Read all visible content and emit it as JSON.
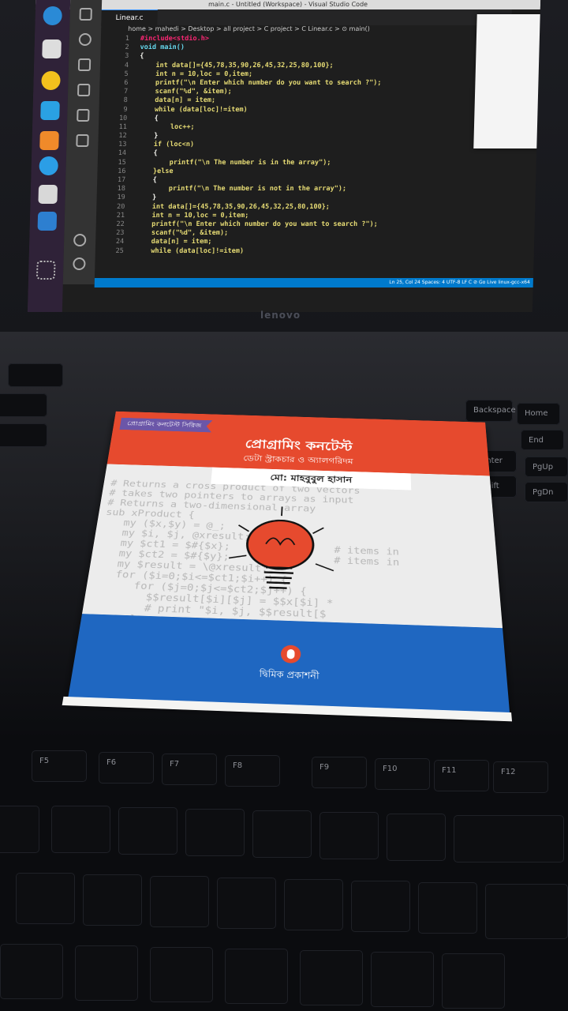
{
  "window_title": "main.c - Untitled (Workspace) - Visual Studio Code",
  "tab": {
    "label": "Linear.c"
  },
  "breadcrumb": "home > mahedi > Desktop > all project > C project > C Linear.c > ⊙ main()",
  "code_lines": [
    {
      "n": "1",
      "t": "#include<stdio.h>",
      "c": "pp"
    },
    {
      "n": "2",
      "t": "void main()",
      "c": "kw"
    },
    {
      "n": "3",
      "t": "{",
      "c": "plain"
    },
    {
      "n": "4",
      "t": "    int data[]={45,78,35,90,26,45,32,25,80,100};",
      "c": "code"
    },
    {
      "n": "5",
      "t": "    int n = 10,loc = 0,item;",
      "c": "code"
    },
    {
      "n": "6",
      "t": "    printf(\"\\n Enter which number do you want to search ?\");",
      "c": "code"
    },
    {
      "n": "7",
      "t": "    scanf(\"%d\", &item);",
      "c": "code"
    },
    {
      "n": "8",
      "t": "    data[n] = item;",
      "c": "code"
    },
    {
      "n": "9",
      "t": "    while (data[loc]!=item)",
      "c": "code"
    },
    {
      "n": "10",
      "t": "    {",
      "c": "plain"
    },
    {
      "n": "11",
      "t": "        loc++;",
      "c": "code"
    },
    {
      "n": "12",
      "t": "    }",
      "c": "plain"
    },
    {
      "n": "13",
      "t": "    if (loc<n)",
      "c": "code"
    },
    {
      "n": "14",
      "t": "    {",
      "c": "plain"
    },
    {
      "n": "15",
      "t": "        printf(\"\\n The number is in the array\");",
      "c": "code"
    },
    {
      "n": "16",
      "t": "    }else",
      "c": "code"
    },
    {
      "n": "17",
      "t": "    {",
      "c": "plain"
    },
    {
      "n": "18",
      "t": "        printf(\"\\n The number is not in the array\");",
      "c": "code"
    },
    {
      "n": "19",
      "t": "    }",
      "c": "plain"
    },
    {
      "n": "20",
      "t": "    int data[]={45,78,35,90,26,45,32,25,80,100};",
      "c": "code"
    },
    {
      "n": "21",
      "t": "    int n = 10,loc = 0,item;",
      "c": "code"
    },
    {
      "n": "22",
      "t": "    printf(\"\\n Enter which number do you want to search ?\");",
      "c": "code"
    },
    {
      "n": "23",
      "t": "    scanf(\"%d\", &item);",
      "c": "code"
    },
    {
      "n": "24",
      "t": "    data[n] = item;",
      "c": "code"
    },
    {
      "n": "25",
      "t": "    while (data[loc]!=item)",
      "c": "code"
    }
  ],
  "status_right": "Ln 25, Col 24   Spaces: 4   UTF-8   LF   C   ⊘ Go Live   linux-gcc-x64",
  "laptop_brand": "lenovo",
  "keys": [
    "F5",
    "F6",
    "F7",
    "F8",
    "F9",
    "F10",
    "F11",
    "F12",
    "Enter",
    "Shift",
    "Backspace",
    "Home",
    "End",
    "PgUp",
    "PgDn"
  ],
  "book": {
    "series": "প্রোগ্রামিং কনটেস্ট সিরিজ",
    "title": "প্রোগ্রামিং কনটেস্ট",
    "subtitle": "ডেটা স্ট্রাকচার ও অ্যালগরিদম",
    "author": "মো: মাহবুবুল হাসান",
    "publisher": "দ্বিমিক প্রকাশনী",
    "background_code": "# Returns a cross product of two vectors\n# takes two pointers to arrays as input\n# Returns a two-dimensional array\nsub xProduct {\n   my ($x,$y) = @_;\n   my $i, $j, @xresult;\n   my $ct1 = $#{$x};                # items in\n   my $ct2 = $#{$y};                # items in\n   my $result = \\@xresult;\n   for ($i=0;$i<=$ct1;$i++) {\n      for ($j=0;$j<=$ct2;$j++) {\n        $$result[$i][$j] = $$x[$i] *\n        # print \"$i, $j, $$result[$\n      }\n   }",
    "colors": {
      "top": "#e64a2e",
      "bottom": "#1f67c1",
      "series_tag": "#6b56a8"
    }
  }
}
